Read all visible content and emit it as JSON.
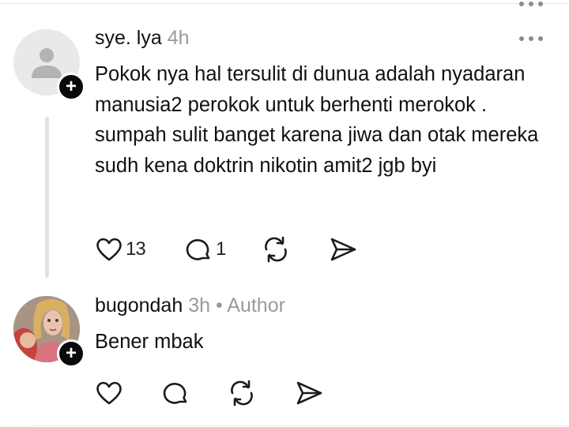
{
  "posts": [
    {
      "username": "sye. lya",
      "time": "4h",
      "author_tag": "",
      "text": "Pokok nya hal tersulit di dunua adalah nyadaran manusia2 perokok untuk berhenti merokok . sumpah sulit banget karena jiwa dan otak mereka sudh kena doktrin nikotin amit2 jgb byi",
      "likes": "13",
      "replies": "1",
      "icons": {
        "like": "heart-icon",
        "reply": "comment-icon",
        "repost": "repost-icon",
        "share": "send-icon",
        "more": "more-icon",
        "follow": "plus-icon"
      }
    },
    {
      "username": "bugondah",
      "time": "3h",
      "author_tag": "• Author",
      "text": "Bener mbak",
      "likes": "",
      "replies": "",
      "icons": {
        "like": "heart-icon",
        "reply": "comment-icon",
        "repost": "repost-icon",
        "share": "send-icon",
        "more": "more-icon",
        "follow": "plus-icon"
      }
    }
  ],
  "follow_label": "+",
  "colors": {
    "text": "#111111",
    "meta": "#9a9a9a",
    "icon": "#1a1a1a",
    "thread_line": "#e2e2e2"
  }
}
